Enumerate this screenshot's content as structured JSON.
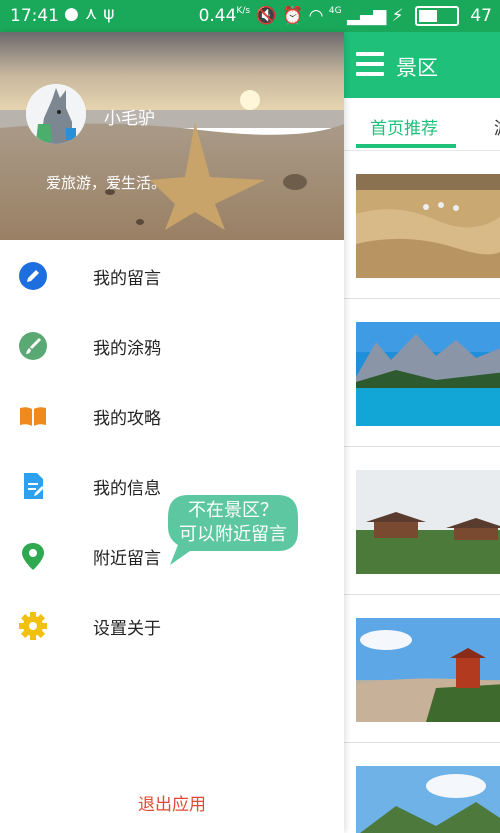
{
  "status_bar": {
    "time": "17:41",
    "network_speed": "0.44",
    "speed_unit": "K/s",
    "network_type": "4G",
    "battery": "47"
  },
  "main": {
    "toolbar_title": "景区",
    "tabs": [
      {
        "label": "首页推荐"
      },
      {
        "label": "游"
      }
    ]
  },
  "drawer": {
    "username": "小毛驴",
    "motto": "爱旅游，爱生活。",
    "menu": [
      {
        "label": "我的留言",
        "icon": "pencil-icon",
        "color": "#1d6fe0"
      },
      {
        "label": "我的涂鸦",
        "icon": "brush-icon",
        "color": "#5aa873"
      },
      {
        "label": "我的攻略",
        "icon": "book-icon",
        "color": "#f08a1e"
      },
      {
        "label": "我的信息",
        "icon": "document-icon",
        "color": "#2ea0f0"
      },
      {
        "label": "附近留言",
        "icon": "location-pin-icon",
        "color": "#2fa84f"
      },
      {
        "label": "设置关于",
        "icon": "gear-icon",
        "color": "#f2c10f"
      }
    ],
    "logout": "退出应用"
  },
  "tooltip": {
    "line1": "不在景区？",
    "line2": "可以附近留言"
  },
  "colors": {
    "status_bar": "#1aa85a",
    "accent": "#1ec07a",
    "logout": "#e04a36",
    "bubble": "#5cc7a1"
  }
}
